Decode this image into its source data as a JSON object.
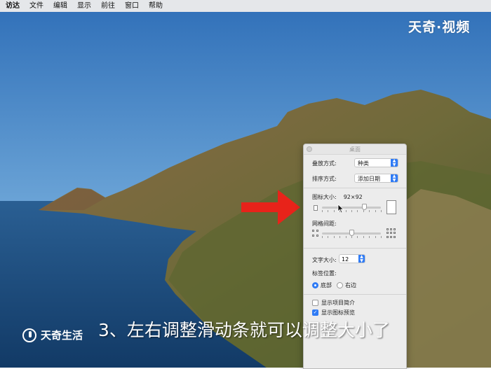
{
  "menubar": {
    "items": [
      "访达",
      "文件",
      "编辑",
      "显示",
      "前往",
      "窗口",
      "帮助"
    ]
  },
  "watermarks": {
    "top": "天奇·视频",
    "bottom": "天奇生活"
  },
  "subtitle": "3、左右调整滑动条就可以调整大小了",
  "panel": {
    "title": "桌面",
    "stack_by_label": "叠放方式:",
    "stack_by_value": "种类",
    "sort_by_label": "排序方式:",
    "sort_by_value": "添加日期",
    "icon_size_label": "图标大小:",
    "icon_size_value": "92×92",
    "icon_size_level": 0.72,
    "grid_spacing_label": "网格间距:",
    "grid_spacing_level": 0.5,
    "text_size_label": "文字大小:",
    "text_size_value": "12",
    "label_position_label": "标签位置:",
    "label_bottom": "底部",
    "label_right": "右边",
    "label_position_selected": "底部",
    "show_item_info": "显示项目简介",
    "show_item_info_checked": false,
    "show_icon_preview": "显示图标预览",
    "show_icon_preview_checked": true
  },
  "colors": {
    "accent": "#2f7bf5",
    "arrow": "#e8231a"
  }
}
